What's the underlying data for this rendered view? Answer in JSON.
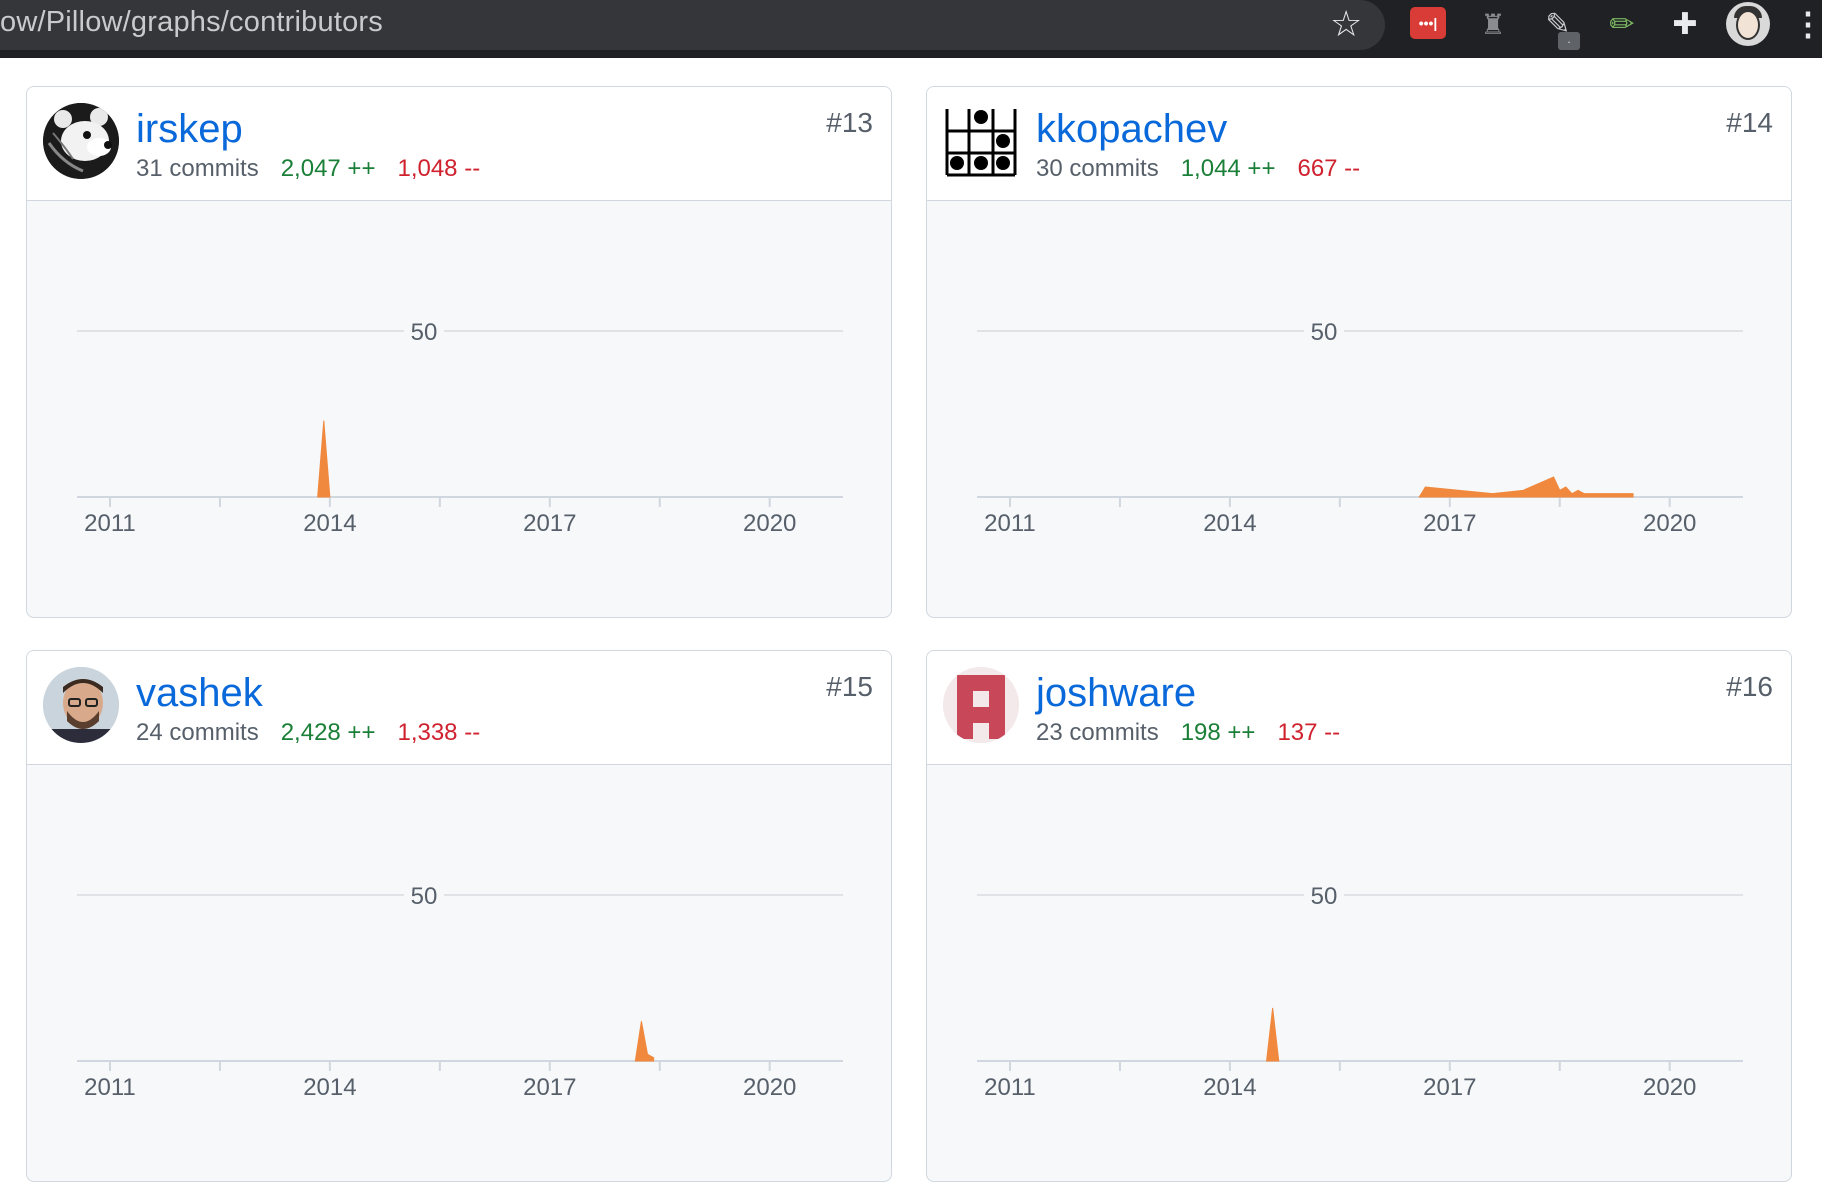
{
  "browser": {
    "url": "ow/Pillow/graphs/contributors",
    "icons": [
      "star-icon",
      "pocket-icon",
      "chess-icon",
      "pen-icon",
      "pencil-ruler-icon",
      "puzzle-icon",
      "profile-avatar",
      "menu-icon"
    ]
  },
  "colors": {
    "link": "#0969da",
    "additions": "#1a7f37",
    "deletions": "#cf222e",
    "area": "#f0883e"
  },
  "contributors": [
    {
      "login": "irskep",
      "rank": "#13",
      "commits": "31 commits",
      "additions": "2,047 ++",
      "deletions": "1,048 --"
    },
    {
      "login": "kkopachev",
      "rank": "#14",
      "commits": "30 commits",
      "additions": "1,044 ++",
      "deletions": "667 --"
    },
    {
      "login": "vashek",
      "rank": "#15",
      "commits": "24 commits",
      "additions": "2,428 ++",
      "deletions": "1,338 --"
    },
    {
      "login": "joshware",
      "rank": "#16",
      "commits": "23 commits",
      "additions": "198 ++",
      "deletions": "137 --"
    }
  ],
  "chart_data": [
    {
      "type": "area",
      "series": [
        {
          "x": [
            "2013-11",
            "2013-12",
            "2014-01"
          ],
          "y": [
            0,
            23,
            0
          ]
        }
      ],
      "xticks": [
        "2011",
        "2014",
        "2017",
        "2020"
      ],
      "yticks": [
        "50"
      ],
      "xlim": [
        2010.55,
        2021.0
      ],
      "ylim": [
        0,
        50
      ]
    },
    {
      "type": "area",
      "series": [
        {
          "x": [
            "2016-08",
            "2016-09",
            "2017-08",
            "2018-01",
            "2018-06",
            "2018-07",
            "2018-08",
            "2018-09",
            "2018-10",
            "2018-11",
            "2019-01",
            "2019-04",
            "2019-07"
          ],
          "y": [
            0,
            3,
            1,
            2,
            6,
            2,
            3,
            1,
            2,
            1,
            1,
            1,
            1
          ]
        }
      ],
      "xticks": [
        "2011",
        "2014",
        "2017",
        "2020"
      ],
      "yticks": [
        "50"
      ],
      "xlim": [
        2010.55,
        2021.0
      ],
      "ylim": [
        0,
        50
      ]
    },
    {
      "type": "area",
      "series": [
        {
          "x": [
            "2018-03",
            "2018-04",
            "2018-05",
            "2018-06"
          ],
          "y": [
            0,
            12,
            2,
            1
          ]
        }
      ],
      "xticks": [
        "2011",
        "2014",
        "2017",
        "2020"
      ],
      "yticks": [
        "50"
      ],
      "xlim": [
        2010.55,
        2021.0
      ],
      "ylim": [
        0,
        50
      ]
    },
    {
      "type": "area",
      "series": [
        {
          "x": [
            "2014-07",
            "2014-08",
            "2014-09"
          ],
          "y": [
            0,
            16,
            0
          ]
        }
      ],
      "xticks": [
        "2011",
        "2014",
        "2017",
        "2020"
      ],
      "yticks": [
        "50"
      ],
      "xlim": [
        2010.55,
        2021.0
      ],
      "ylim": [
        0,
        50
      ]
    }
  ]
}
